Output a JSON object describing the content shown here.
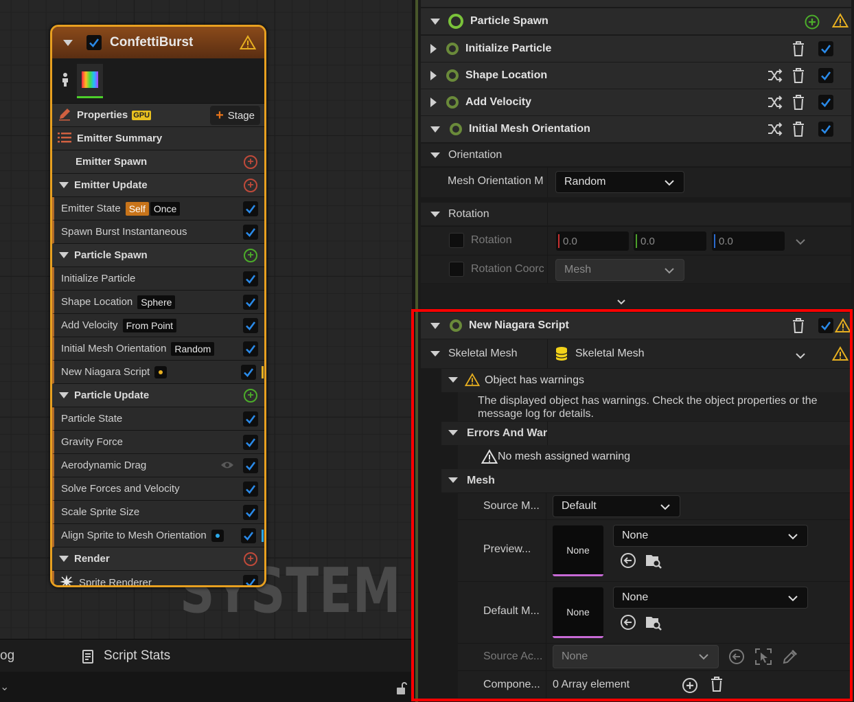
{
  "graph": {
    "watermark": "SYSTEM",
    "node": {
      "title": "ConfettiBurst",
      "properties_label": "Properties",
      "gpu_badge": "GPU",
      "stage_button": "Stage",
      "emitter_summary": "Emitter Summary",
      "emitter_spawn": "Emitter Spawn",
      "emitter_update": "Emitter Update",
      "emitter_state": "Emitter State",
      "emitter_state_tag1": "Self",
      "emitter_state_tag2": "Once",
      "spawn_burst": "Spawn Burst Instantaneous",
      "particle_spawn": "Particle Spawn",
      "initialize_particle": "Initialize Particle",
      "shape_location": "Shape Location",
      "shape_location_tag": "Sphere",
      "add_velocity": "Add Velocity",
      "add_velocity_tag": "From Point",
      "initial_mesh_orientation": "Initial Mesh Orientation",
      "initial_mesh_orientation_tag": "Random",
      "new_niagara_script": "New Niagara Script",
      "particle_update": "Particle Update",
      "particle_state": "Particle State",
      "gravity_force": "Gravity Force",
      "aerodynamic_drag": "Aerodynamic Drag",
      "solve_forces": "Solve Forces and Velocity",
      "scale_sprite": "Scale Sprite Size",
      "align_sprite": "Align Sprite to Mesh Orientation",
      "render": "Render",
      "sprite_renderer": "Sprite Renderer"
    }
  },
  "bottom": {
    "tab_log_partial": "og",
    "tab_script_stats": "Script Stats"
  },
  "details": {
    "modules": {
      "particle_spawn": "Particle Spawn",
      "initialize_particle": "Initialize Particle",
      "shape_location": "Shape Location",
      "add_velocity": "Add Velocity",
      "initial_mesh_orientation": "Initial Mesh Orientation"
    },
    "orientation_section": "Orientation",
    "mesh_orientation_label": "Mesh Orientation M",
    "mesh_orientation_value": "Random",
    "rotation_section": "Rotation",
    "rotation_label": "Rotation",
    "rotation_x": "0.0",
    "rotation_y": "0.0",
    "rotation_z": "0.0",
    "rotation_coord_label": "Rotation Coorc",
    "rotation_coord_value": "Mesh",
    "new_script": {
      "title": "New Niagara Script",
      "skeletal_mesh_label": "Skeletal Mesh",
      "skeletal_mesh_value": "Skeletal Mesh",
      "warnings_header": "Object has warnings",
      "warnings_text": "The displayed object has warnings.  Check the object properties or the message log for details.",
      "errors_section": "Errors And War",
      "no_mesh_warning": "No mesh assigned warning",
      "mesh_section": "Mesh",
      "source_mode_label": "Source M...",
      "source_mode_value": "Default",
      "preview_label": "Preview...",
      "preview_thumb": "None",
      "preview_value": "None",
      "default_mesh_label": "Default M...",
      "default_thumb": "None",
      "default_value": "None",
      "source_actor_label": "Source Ac...",
      "source_actor_value": "None",
      "components_label": "Compone...",
      "components_value": "0 Array element"
    }
  },
  "colors": {
    "node_border": "#e8a020",
    "checkbox_blue": "#2a7ad8",
    "highlight": "#ff0000",
    "warning": "#e8b020"
  }
}
